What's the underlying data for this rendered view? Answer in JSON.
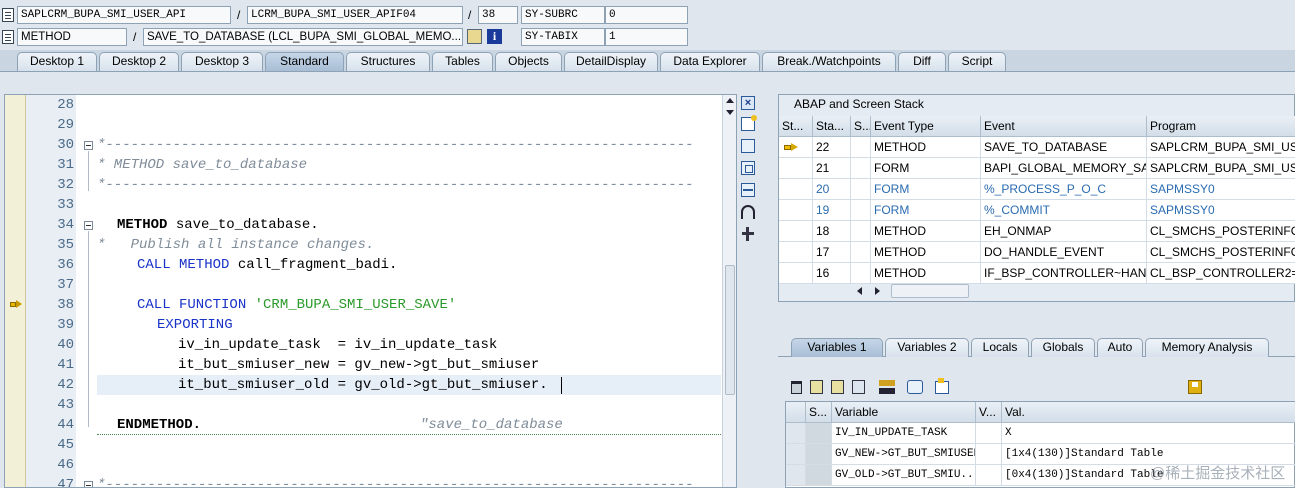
{
  "header": {
    "row1": {
      "program": "SAPLCRM_BUPA_SMI_USER_API",
      "include": "LCRM_BUPA_SMI_USER_APIF04",
      "line": "38",
      "sysvar_name": "SY-SUBRC",
      "sysvar_value": "0"
    },
    "row2": {
      "event_type": "METHOD",
      "event": "SAVE_TO_DATABASE (LCL_BUPA_SMI_GLOBAL_MEMO...",
      "sysvar_name": "SY-TABIX",
      "sysvar_value": "1"
    },
    "sep": "/"
  },
  "tabs": [
    "Desktop 1",
    "Desktop 2",
    "Desktop 3",
    "Standard",
    "Structures",
    "Tables",
    "Objects",
    "DetailDisplay",
    "Data Explorer",
    "Break./Watchpoints",
    "Diff",
    "Script"
  ],
  "active_tab": "Standard",
  "editor": {
    "lines": [
      {
        "n": "28"
      },
      {
        "n": "29"
      },
      {
        "n": "30"
      },
      {
        "n": "31"
      },
      {
        "n": "32"
      },
      {
        "n": "33"
      },
      {
        "n": "34"
      },
      {
        "n": "35"
      },
      {
        "n": "36"
      },
      {
        "n": "37"
      },
      {
        "n": "38"
      },
      {
        "n": "39"
      },
      {
        "n": "40"
      },
      {
        "n": "41"
      },
      {
        "n": "42"
      },
      {
        "n": "43"
      },
      {
        "n": "44"
      },
      {
        "n": "45"
      },
      {
        "n": "46"
      },
      {
        "n": "47"
      }
    ],
    "code": {
      "c30": "*----------------------------------------------------------------------",
      "c31": "* METHOD save_to_database",
      "c32": "*----------------------------------------------------------------------",
      "c34_kw": "METHOD",
      "c34_rest": " save_to_database.",
      "c35": "*   Publish all instance changes.",
      "c36_kw": "CALL METHOD",
      "c36_rest": " call_fragment_badi.",
      "c38_kw": "CALL FUNCTION",
      "c38_str": "'CRM_BUPA_SMI_USER_SAVE'",
      "c39_kw": "EXPORTING",
      "c40": "iv_in_update_task  = iv_in_update_task",
      "c41": "it_but_smiuser_new = gv_new->gt_but_smiuser",
      "c42": "it_but_smiuser_old = gv_old->gt_but_smiuser.",
      "c44_kw": "ENDMETHOD.",
      "c44_cmt": "\"save_to_database",
      "c47": "*----------------------------------------------------------------------"
    }
  },
  "stack": {
    "title": "ABAP and Screen Stack",
    "columns": [
      "St...",
      "Sta...",
      "S...",
      "Event Type",
      "Event",
      "Program"
    ],
    "rows": [
      {
        "level": "22",
        "type": "METHOD",
        "event": "SAVE_TO_DATABASE",
        "program": "SAPLCRM_BUPA_SMI_US...",
        "current": true,
        "blue": false
      },
      {
        "level": "21",
        "type": "FORM",
        "event": "BAPI_GLOBAL_MEMORY_SA...",
        "program": "SAPLCRM_BUPA_SMI_US...",
        "current": false,
        "blue": false
      },
      {
        "level": "20",
        "type": "FORM",
        "event": "%_PROCESS_P_O_C",
        "program": "SAPMSSY0",
        "current": false,
        "blue": true
      },
      {
        "level": "19",
        "type": "FORM",
        "event": "%_COMMIT",
        "program": "SAPMSSY0",
        "current": false,
        "blue": true
      },
      {
        "level": "18",
        "type": "METHOD",
        "event": "EH_ONMAP",
        "program": "CL_SMCHS_POSTERINFO...",
        "current": false,
        "blue": false
      },
      {
        "level": "17",
        "type": "METHOD",
        "event": "DO_HANDLE_EVENT",
        "program": "CL_SMCHS_POSTERINFO...",
        "current": false,
        "blue": false
      },
      {
        "level": "16",
        "type": "METHOD",
        "event": "IF_BSP_CONTROLLER~HAN...",
        "program": "CL_BSP_CONTROLLER2=...",
        "current": false,
        "blue": false
      }
    ]
  },
  "var_tabs": [
    "Variables 1",
    "Variables 2",
    "Locals",
    "Globals",
    "Auto",
    "Memory Analysis"
  ],
  "active_var_tab": "Variables 1",
  "variables": {
    "columns": [
      "S...",
      "Variable",
      "V...",
      "Val."
    ],
    "rows": [
      {
        "name": "IV_IN_UPDATE_TASK",
        "value": "X"
      },
      {
        "name": "GV_NEW->GT_BUT_SMIUSER",
        "value": "[1x4(130)]Standard Table"
      },
      {
        "name": "GV_OLD->GT_BUT_SMIU...",
        "value": "[0x4(130)]Standard Table"
      }
    ]
  },
  "watermark": "@稀土掘金技术社区",
  "colors": {
    "accent": "#1a33c8",
    "string": "#2a9a2a",
    "comment": "#7f8c99",
    "blue_row": "#2a6bb0"
  }
}
